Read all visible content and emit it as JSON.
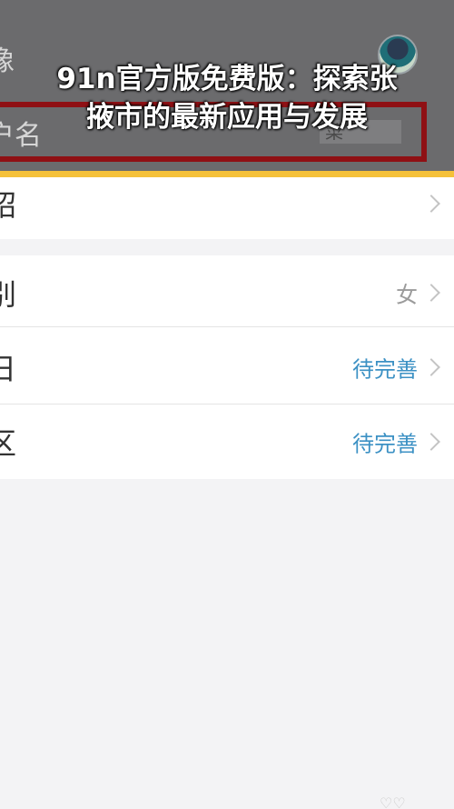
{
  "banner": {
    "headline_line1": "91n官方版免费版：探索张",
    "headline_line2": "掖市的最新应用与发展",
    "row1_label": "像",
    "row2_label": "户名",
    "name_value": "菜"
  },
  "list": {
    "intro": {
      "label": "绍"
    },
    "gender": {
      "label": "别",
      "value": "女"
    },
    "birthday": {
      "label": "日",
      "value": "待完善"
    },
    "region": {
      "label": "区",
      "value": "待完善"
    }
  },
  "colors": {
    "accent_yellow": "#f5c13a",
    "highlight_red": "#8f1014",
    "link_blue": "#3c91c4"
  }
}
